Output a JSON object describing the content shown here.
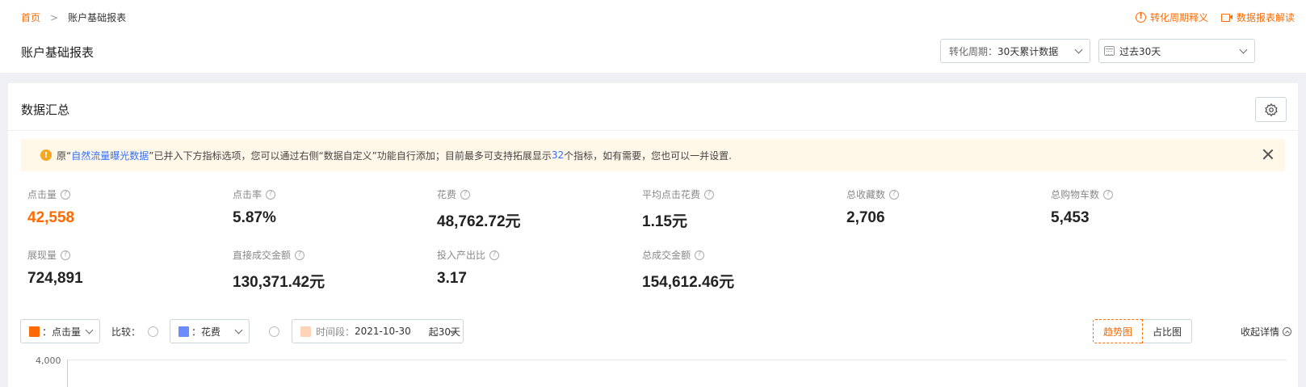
{
  "breadcrumb": {
    "home": "首页",
    "separator": ">",
    "current": "账户基础报表"
  },
  "header_links": {
    "cycle_explain": "转化周期释义",
    "report_explain": "数据报表解读"
  },
  "page_title": "账户基础报表",
  "filters": {
    "cycle_key": "转化周期：",
    "cycle_value": "30天累计数据",
    "date_range": "过去30天"
  },
  "summary": {
    "title": "数据汇总",
    "notice": {
      "prefix": "原“",
      "highlight": "自然流量曝光数据",
      "middle": "”已并入下方指标选项，您可以通过右侧“数据自定义”功能自行添加；目前最多可支持拓展显示",
      "count": "32",
      "suffix": "个指标，如有需要，您也可以一并设置."
    },
    "metrics": [
      {
        "label": "点击量",
        "value": "42,558"
      },
      {
        "label": "点击率",
        "value": "5.87%"
      },
      {
        "label": "花费",
        "value": "48,762.72元"
      },
      {
        "label": "平均点击花费",
        "value": "1.15元"
      },
      {
        "label": "总收藏数",
        "value": "2,706"
      },
      {
        "label": "总购物车数",
        "value": "5,453"
      },
      {
        "label": "展现量",
        "value": "724,891"
      },
      {
        "label": "直接成交金额",
        "value": "130,371.42元"
      },
      {
        "label": "投入产出比",
        "value": "3.17"
      },
      {
        "label": "总成交金额",
        "value": "154,612.46元"
      }
    ]
  },
  "chart_controls": {
    "metric1": {
      "label": "：点击量",
      "color": "#ff6a00"
    },
    "compare_label": "比较：",
    "metric2": {
      "label": "：花费",
      "color": "#6b8cff"
    },
    "period": {
      "key": "时间段：",
      "value": "2021-10-30",
      "suffix": "起30天",
      "color": "#ffd3b8"
    },
    "views": [
      "趋势图",
      "占比图"
    ],
    "collapse": "收起详情"
  },
  "chart": {
    "y_top_label": "4,000"
  },
  "colors": {
    "accent": "#ff6a00",
    "link": "#3370ff",
    "notice_bg": "#fff7e8"
  }
}
